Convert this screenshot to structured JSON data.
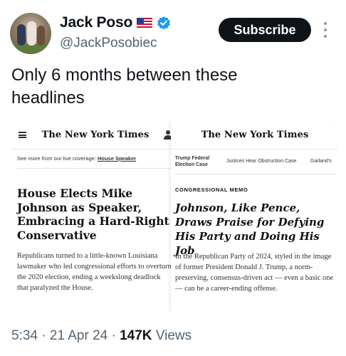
{
  "author": {
    "display_name": "Jack Poso",
    "handle": "@JackPosobiec"
  },
  "subscribe_label": "Subscribe",
  "tweet_text": "Only 6 months between these headlines",
  "media": {
    "left": {
      "logo": "The New York Times",
      "live_prefix": "See more from our live coverage: ",
      "live_link": "House Speaker",
      "headline": "House Elects Mike Johnson as Speaker, Embracing a Hard-Right Conservative",
      "summary": "Republicans turned to a little-known Louisiana lawmaker who led congressional efforts to overturn the 2020 election, ending a weekslong deadlock that paralyzed the House."
    },
    "right": {
      "logo": "The New York Times",
      "nav": [
        "Trump Federal Election Case",
        "Justices Hear Obstruction Case",
        "Garland's"
      ],
      "kicker": "CONGRESSIONAL MEMO",
      "headline": "Johnson, Like Pence, Draws Praise for Defying His Party and Doing His Job",
      "summary": "In the Republican Party of 2024, styled in the image of former President Donald J. Trump, a norm-preserving, consensus-driven act — even a basic one — can be a career-ending offense."
    }
  },
  "meta": {
    "time": "5:34",
    "date": "21 Apr 24",
    "views_count": "147K",
    "views_label": "Views"
  },
  "colors": {
    "verified_blue": "#1d9bf0",
    "secondary_text": "#536471"
  }
}
